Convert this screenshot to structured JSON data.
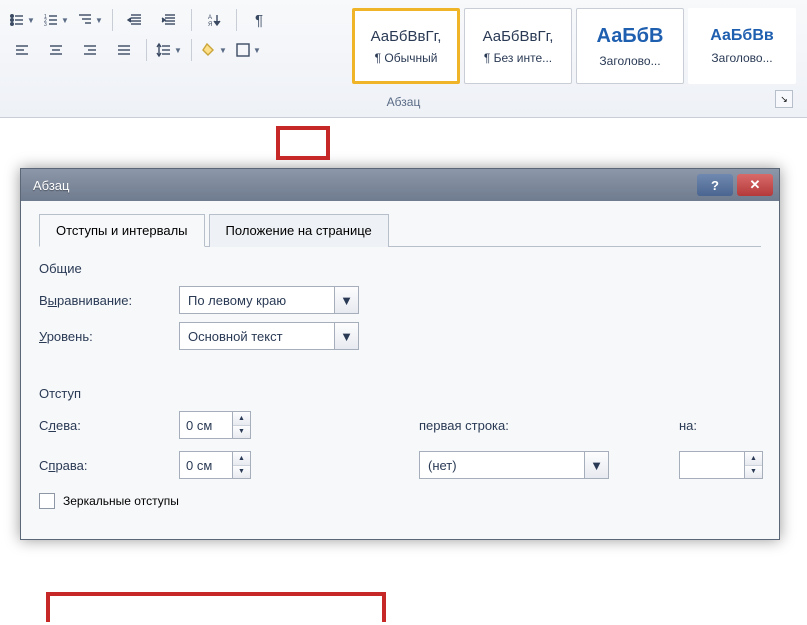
{
  "ribbon": {
    "group_label": "Абзац",
    "styles": [
      {
        "preview": "АаБбВвГг,",
        "name": "¶ Обычный",
        "class": "normal",
        "selected": true
      },
      {
        "preview": "АаБбВвГг,",
        "name": "¶ Без инте...",
        "class": "normal",
        "selected": false
      },
      {
        "preview": "АаБбВ",
        "name": "Заголово...",
        "class": "heading1",
        "selected": false
      },
      {
        "preview": "АаБбВв",
        "name": "Заголово...",
        "class": "heading2",
        "selected": false
      }
    ]
  },
  "dialog": {
    "title": "Абзац",
    "tabs": {
      "indents": "Отступы и интервалы",
      "position": "Положение на странице"
    },
    "general": {
      "heading": "Общие",
      "alignment_label": "Выравнивание:",
      "alignment_value": "По левому краю",
      "level_label": "Уровень:",
      "level_value": "Основной текст"
    },
    "indent": {
      "heading": "Отступ",
      "left_label": "Слева:",
      "left_value": "0 см",
      "right_label": "Справа:",
      "right_value": "0 см",
      "first_line_label": "первая строка:",
      "first_line_value": "(нет)",
      "by_label": "на:",
      "by_value": "",
      "mirror_label": "Зеркальные отступы"
    }
  }
}
